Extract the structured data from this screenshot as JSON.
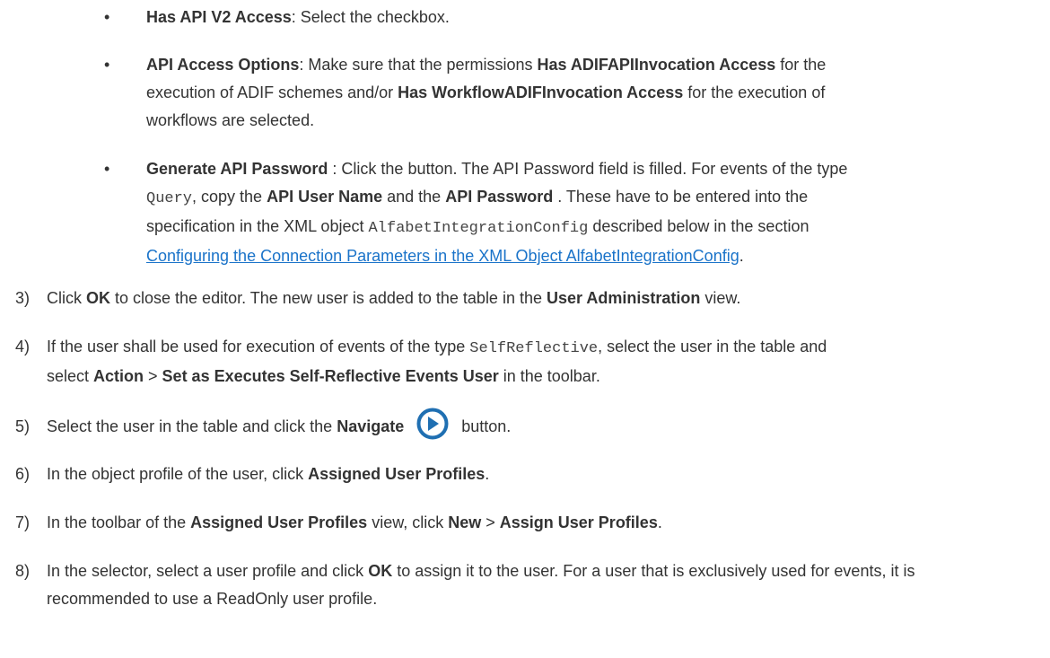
{
  "bullets": [
    {
      "term": "Has API V2 Access",
      "text": ": Select the checkbox."
    },
    {
      "term": "API Access Options",
      "t1": ": Make sure that the permissions ",
      "perm1": "Has ADIFAPIInvocation Access",
      "t2": " for the execution of ADIF schemes and/or ",
      "perm2": "Has WorkflowADIFInvocation Access",
      "t3": " for the execution of workflows are selected."
    },
    {
      "term": "Generate API Password",
      "t1": " : Click the button. The API Password field is filled. For events of the type ",
      "code1": "Query",
      "t2": ", copy the ",
      "b1": "API User Name",
      "t3": " and the ",
      "b2": "API Password",
      "t4": " . These have to be entered into the specification in the XML object ",
      "code2": "AlfabetIntegrationConfig",
      "t5": " described below in the section ",
      "link": "Configuring the Connection Parameters in the XML Object AlfabetIntegrationConfig",
      "t6": "."
    }
  ],
  "steps": {
    "s3": {
      "num": "3)",
      "t1": "Click ",
      "b1": "OK",
      "t2": " to close the editor. The new user is added to the table in the ",
      "b2": "User Administration",
      "t3": " view."
    },
    "s4": {
      "num": "4)",
      "t1": "If the user shall be used for execution of events of the type ",
      "code1": "SelfReflective",
      "t2": ", select the user in the table and select ",
      "b1": "Action",
      "t3": " > ",
      "b2": "Set as Executes Self-Reflective Events User",
      "t4": " in the toolbar."
    },
    "s5": {
      "num": "5)",
      "t1": "Select the user in the table and click the ",
      "b1": "Navigate",
      "t2": "button.",
      "icon": "navigate-arrow-icon"
    },
    "s6": {
      "num": "6)",
      "t1": "In the object profile of the user, click ",
      "b1": "Assigned User Profiles",
      "t2": "."
    },
    "s7": {
      "num": "7)",
      "t1": "In the toolbar of the ",
      "b1": "Assigned User Profiles",
      "t2": " view, click ",
      "b2": "New",
      "t3": " > ",
      "b3": "Assign User Profiles",
      "t4": "."
    },
    "s8": {
      "num": "8)",
      "t1": "In the selector, select a user profile and click ",
      "b1": "OK",
      "t2": " to assign it to the user. For a user that is exclusively used for events, it is recommended to use a ReadOnly user profile."
    }
  },
  "colors": {
    "text": "#333333",
    "link": "#1a73c9",
    "icon": "#1f6fb2"
  }
}
